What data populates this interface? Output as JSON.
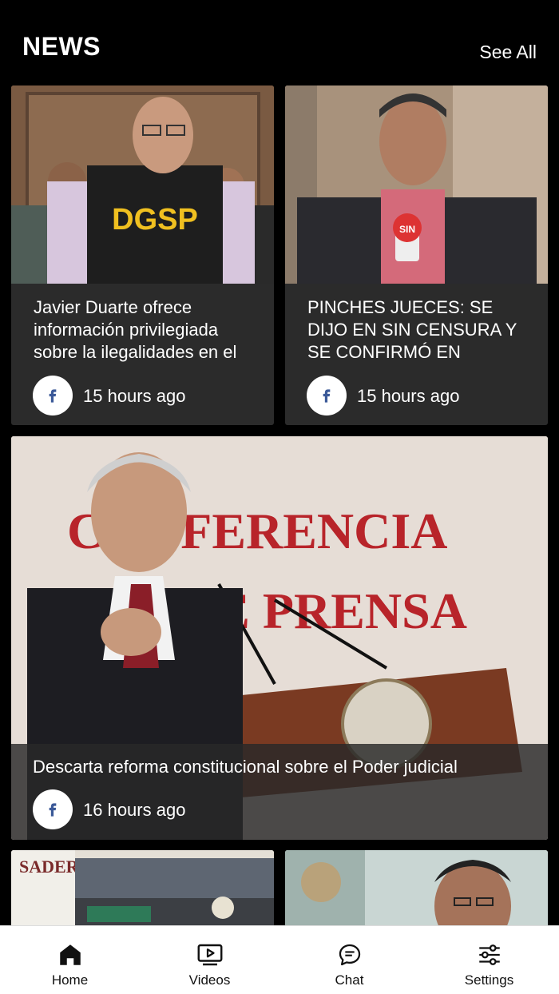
{
  "header": {
    "title": "NEWS",
    "see_all": "See All"
  },
  "articles": [
    {
      "headline": "Javier Duarte ofrece información privilegiada sobre la ilegalidades en el",
      "time": "15 hours ago",
      "source_icon": "facebook-icon"
    },
    {
      "headline": "PINCHES JUECES: SE DIJO EN SIN CENSURA Y SE CONFIRMÓ EN",
      "time": "15 hours ago",
      "source_icon": "facebook-icon"
    },
    {
      "headline": "Descarta reforma constitucional sobre el Poder judicial",
      "time": "16 hours ago",
      "source_icon": "facebook-icon"
    }
  ],
  "photo_text": {
    "vest": "DGSP",
    "mic": "SIN",
    "banner_line1": "CONFERENCIA",
    "banner_line2": "DE PRENSA",
    "sader": "SADER"
  },
  "nav": [
    {
      "label": "Home",
      "icon": "home-icon"
    },
    {
      "label": "Videos",
      "icon": "video-icon"
    },
    {
      "label": "Chat",
      "icon": "chat-icon"
    },
    {
      "label": "Settings",
      "icon": "settings-icon"
    }
  ],
  "colors": {
    "background": "#000000",
    "card": "#2b2b2b",
    "facebook": "#3b5998"
  }
}
